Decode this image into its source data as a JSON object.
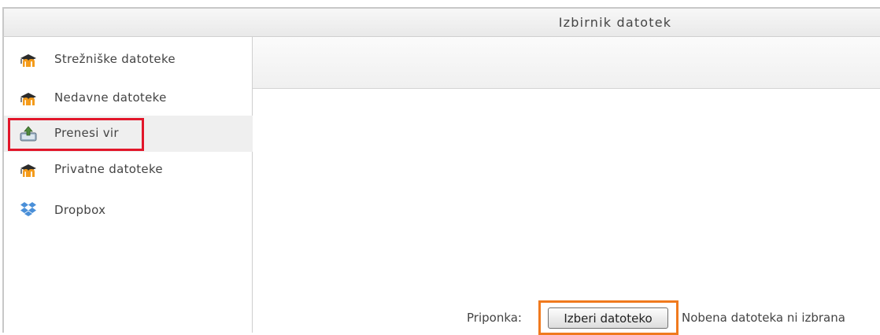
{
  "window": {
    "title": "Izbirnik datotek"
  },
  "sidebar": {
    "items": [
      {
        "label": "Strežniške datoteke",
        "icon": "moodle-icon",
        "active": false
      },
      {
        "label": "Nedavne datoteke",
        "icon": "moodle-icon",
        "active": false
      },
      {
        "label": "Prenesi vir",
        "icon": "upload-icon",
        "active": true
      },
      {
        "label": "Privatne datoteke",
        "icon": "moodle-icon",
        "active": false
      },
      {
        "label": "Dropbox",
        "icon": "dropbox-icon",
        "active": false
      }
    ]
  },
  "upload": {
    "attachment_label": "Priponka:",
    "choose_button_label": "Izberi datoteko",
    "no_file_text": "Nobena datoteka ni izbrana"
  },
  "colors": {
    "red_highlight": "#e2162a",
    "orange_highlight": "#f07a1e",
    "moodle_orange": "#f49b1a",
    "dropbox_blue": "#4a8fd8"
  }
}
